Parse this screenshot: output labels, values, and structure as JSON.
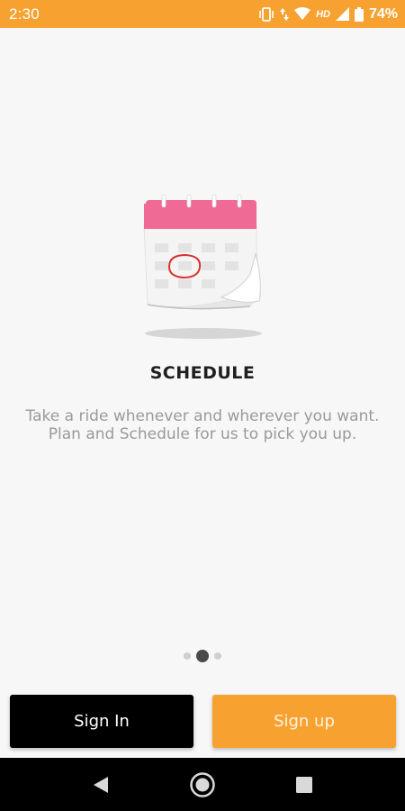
{
  "status_bar": {
    "time": "2:30",
    "network_label": "HD",
    "battery": "74%",
    "background": "#f7a230"
  },
  "onboarding": {
    "title": "SCHEDULE",
    "description": "Take a ride whenever and wherever you want. Plan and Schedule for us to pick you up.",
    "illustration_icon": "calendar-icon",
    "page_count": 3,
    "active_page": 2
  },
  "actions": {
    "sign_in_label": "Sign In",
    "sign_up_label": "Sign up"
  },
  "nav_bar": {
    "back_icon": "back-triangle-icon",
    "home_icon": "home-circle-icon",
    "recents_icon": "recents-square-icon"
  },
  "colors": {
    "accent": "#f7a230",
    "calendar_header": "#ef6a95",
    "marker": "#d8302e"
  }
}
